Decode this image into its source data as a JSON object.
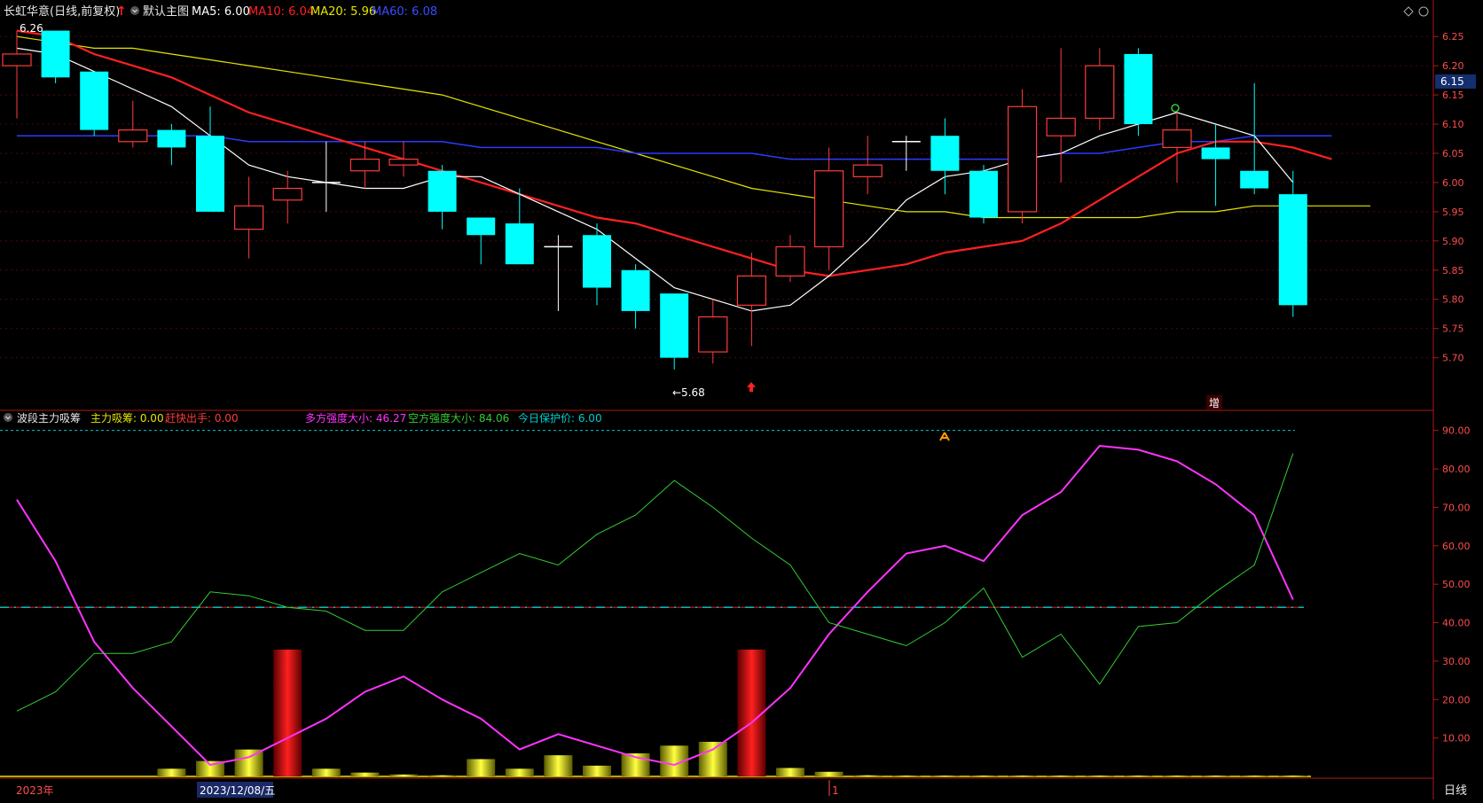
{
  "colors": {
    "up": "#ff3b3b",
    "down": "#00ffff",
    "ma5": "#ffffff",
    "ma10": "#ff2020",
    "ma20": "#e6e600",
    "ma60": "#2a3cff",
    "strong_buy": "#ff33ff",
    "strong_sell": "#33cc33",
    "protect": "#00cccc",
    "axis": "#b01818",
    "label": "#ff4d4d"
  },
  "header": {
    "title": "长虹华意(日线,前复权)",
    "arrow": "↑",
    "main_label": "默认主图",
    "ma5": "MA5: 6.00",
    "ma10": "MA10: 6.04",
    "ma20": "MA20: 5.96",
    "ma60": "MA60: 6.08"
  },
  "indicator_header": {
    "name": "波段主力吸筹",
    "absorb": "主力吸筹: 0.00",
    "escape": "赶快出手: 0.00",
    "bull": "多方强度大小: 46.27",
    "bear": "空方强度大小: 84.06",
    "protect": "今日保护价: 6.00"
  },
  "annotations": {
    "high_label": "6.26",
    "low_label": "←5.68",
    "zeng": "增",
    "current_price": "6.15"
  },
  "footer": {
    "year": "2023年",
    "date": "2023/12/08/五",
    "marker": "1",
    "period": "日线"
  },
  "chart_data": [
    {
      "type": "candlestick",
      "ylim": [
        5.66,
        6.27
      ],
      "y_ticks": [
        "6.25",
        "6.20",
        "6.15",
        "6.10",
        "6.05",
        "6.00",
        "5.95",
        "5.90",
        "5.85",
        "5.80",
        "5.75",
        "5.70"
      ],
      "candles": [
        {
          "o": 6.2,
          "c": 6.22,
          "h": 6.26,
          "l": 6.11
        },
        {
          "o": 6.26,
          "c": 6.18,
          "h": 6.26,
          "l": 6.17
        },
        {
          "o": 6.19,
          "c": 6.09,
          "h": 6.19,
          "l": 6.08
        },
        {
          "o": 6.07,
          "c": 6.09,
          "h": 6.14,
          "l": 6.06
        },
        {
          "o": 6.09,
          "c": 6.06,
          "h": 6.1,
          "l": 6.03
        },
        {
          "o": 6.08,
          "c": 5.95,
          "h": 6.13,
          "l": 5.95
        },
        {
          "o": 5.92,
          "c": 5.96,
          "h": 6.01,
          "l": 5.87
        },
        {
          "o": 5.97,
          "c": 5.99,
          "h": 6.02,
          "l": 5.93
        },
        {
          "o": 6.0,
          "c": 6.0,
          "h": 6.07,
          "l": 5.95
        },
        {
          "o": 6.02,
          "c": 6.04,
          "h": 6.07,
          "l": 5.99
        },
        {
          "o": 6.03,
          "c": 6.04,
          "h": 6.07,
          "l": 6.01
        },
        {
          "o": 6.02,
          "c": 5.95,
          "h": 6.03,
          "l": 5.92
        },
        {
          "o": 5.94,
          "c": 5.91,
          "h": 5.94,
          "l": 5.86
        },
        {
          "o": 5.93,
          "c": 5.86,
          "h": 5.99,
          "l": 5.86
        },
        {
          "o": 5.89,
          "c": 5.89,
          "h": 5.91,
          "l": 5.78
        },
        {
          "o": 5.91,
          "c": 5.82,
          "h": 5.93,
          "l": 5.79
        },
        {
          "o": 5.85,
          "c": 5.78,
          "h": 5.86,
          "l": 5.75
        },
        {
          "o": 5.81,
          "c": 5.7,
          "h": 5.81,
          "l": 5.68
        },
        {
          "o": 5.71,
          "c": 5.77,
          "h": 5.8,
          "l": 5.69
        },
        {
          "o": 5.79,
          "c": 5.84,
          "h": 5.88,
          "l": 5.72
        },
        {
          "o": 5.84,
          "c": 5.89,
          "h": 5.91,
          "l": 5.83
        },
        {
          "o": 5.89,
          "c": 6.02,
          "h": 6.06,
          "l": 5.85
        },
        {
          "o": 6.01,
          "c": 6.03,
          "h": 6.08,
          "l": 5.98
        },
        {
          "o": 6.07,
          "c": 6.07,
          "h": 6.08,
          "l": 6.02
        },
        {
          "o": 6.08,
          "c": 6.02,
          "h": 6.11,
          "l": 5.98
        },
        {
          "o": 6.02,
          "c": 5.94,
          "h": 6.03,
          "l": 5.93
        },
        {
          "o": 5.95,
          "c": 6.13,
          "h": 6.16,
          "l": 5.93
        },
        {
          "o": 6.08,
          "c": 6.11,
          "h": 6.23,
          "l": 6.0
        },
        {
          "o": 6.11,
          "c": 6.2,
          "h": 6.23,
          "l": 6.09
        },
        {
          "o": 6.22,
          "c": 6.1,
          "h": 6.23,
          "l": 6.08
        },
        {
          "o": 6.06,
          "c": 6.09,
          "h": 6.12,
          "l": 6.0
        },
        {
          "o": 6.06,
          "c": 6.04,
          "h": 6.1,
          "l": 5.96
        },
        {
          "o": 6.02,
          "c": 5.99,
          "h": 6.17,
          "l": 5.98
        },
        {
          "o": 5.98,
          "c": 5.79,
          "h": 6.02,
          "l": 5.77
        }
      ],
      "ma5": [
        6.23,
        6.22,
        6.19,
        6.16,
        6.13,
        6.08,
        6.03,
        6.01,
        6.0,
        5.99,
        5.99,
        6.01,
        6.01,
        5.98,
        5.95,
        5.92,
        5.87,
        5.82,
        5.8,
        5.78,
        5.79,
        5.84,
        5.9,
        5.97,
        6.01,
        6.02,
        6.04,
        6.05,
        6.08,
        6.1,
        6.12,
        6.1,
        6.08,
        6.0
      ],
      "ma10": [
        6.26,
        6.25,
        6.22,
        6.2,
        6.18,
        6.15,
        6.12,
        6.1,
        6.08,
        6.06,
        6.04,
        6.02,
        6.0,
        5.98,
        5.96,
        5.94,
        5.93,
        5.91,
        5.89,
        5.87,
        5.85,
        5.84,
        5.85,
        5.86,
        5.88,
        5.89,
        5.9,
        5.93,
        5.97,
        6.01,
        6.05,
        6.07,
        6.07,
        6.06,
        6.04
      ],
      "ma20": [
        6.25,
        6.24,
        6.23,
        6.23,
        6.22,
        6.21,
        6.2,
        6.19,
        6.18,
        6.17,
        6.16,
        6.15,
        6.13,
        6.11,
        6.09,
        6.07,
        6.05,
        6.03,
        6.01,
        5.99,
        5.98,
        5.97,
        5.96,
        5.95,
        5.95,
        5.94,
        5.94,
        5.94,
        5.94,
        5.94,
        5.95,
        5.95,
        5.96,
        5.96,
        5.96,
        5.96
      ],
      "ma60": [
        6.08,
        6.08,
        6.08,
        6.08,
        6.08,
        6.08,
        6.07,
        6.07,
        6.07,
        6.07,
        6.07,
        6.07,
        6.06,
        6.06,
        6.06,
        6.06,
        6.05,
        6.05,
        6.05,
        6.05,
        6.04,
        6.04,
        6.04,
        6.04,
        6.04,
        6.04,
        6.04,
        6.05,
        6.05,
        6.06,
        6.07,
        6.07,
        6.08,
        6.08,
        6.08
      ]
    },
    {
      "type": "line",
      "ylim": [
        0,
        95
      ],
      "y_ticks": [
        "90.00",
        "80.00",
        "70.00",
        "60.00",
        "50.00",
        "40.00",
        "30.00",
        "20.00",
        "10.00"
      ],
      "reference_lines": [
        90,
        44
      ],
      "series": [
        {
          "name": "多方强度大小",
          "values": [
            72,
            56,
            35,
            23,
            13,
            3,
            5,
            10,
            15,
            22,
            26,
            20,
            15,
            7,
            11,
            8,
            5,
            3,
            7,
            14,
            23,
            37,
            48,
            58,
            60,
            56,
            68,
            74,
            86,
            85,
            82,
            76,
            68,
            46
          ]
        },
        {
          "name": "空方强度大小",
          "values": [
            17,
            22,
            32,
            32,
            35,
            48,
            47,
            44,
            43,
            38,
            38,
            48,
            53,
            58,
            55,
            63,
            68,
            77,
            70,
            62,
            55,
            40,
            37,
            34,
            40,
            49,
            31,
            37,
            24,
            39,
            40,
            48,
            55,
            84
          ]
        }
      ],
      "bars": [
        0,
        0,
        0,
        0,
        2,
        4,
        7,
        33,
        2,
        1,
        0.5,
        0.3,
        4.5,
        2,
        5.5,
        2.8,
        6,
        8,
        9,
        33,
        2.2,
        1.2,
        0.3,
        0.2,
        0.2,
        0.2,
        0.2,
        0.2,
        0.2,
        0.2,
        0.2,
        0.2,
        0.2,
        0.2
      ]
    }
  ]
}
